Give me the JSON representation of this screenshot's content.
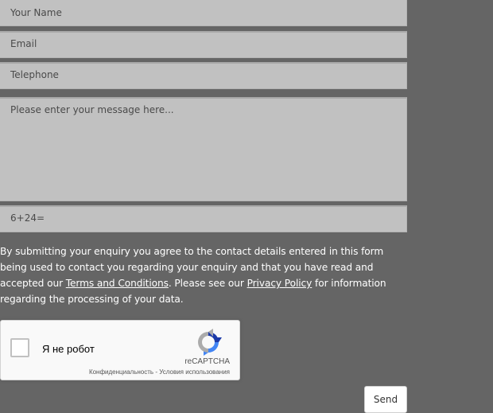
{
  "form": {
    "name_placeholder": "Your Name",
    "email_placeholder": "Email",
    "telephone_placeholder": "Telephone",
    "message_placeholder": "Please enter your message here...",
    "captcha_question": "6+24="
  },
  "disclaimer": {
    "text_1": "By submitting your enquiry you agree to the contact details entered in this form being used to contact you regarding your enquiry and that you have read and accepted our ",
    "terms_link": "Terms and Conditions",
    "text_2": ". Please see our ",
    "privacy_link": "Privacy Policy",
    "text_3": " for information regarding the processing of your data."
  },
  "recaptcha": {
    "label": "Я не робот",
    "brand": "reCAPTCHA",
    "privacy": "Конфиденциальность",
    "separator": " - ",
    "terms": "Условия использования",
    "logo_icon": "recaptcha-logo-icon"
  },
  "send_button": "Send",
  "colors": {
    "background": "#656565",
    "field": "#c1c1c1",
    "field_text": "#4a4a4a",
    "disclaimer_text": "#ffffff"
  }
}
